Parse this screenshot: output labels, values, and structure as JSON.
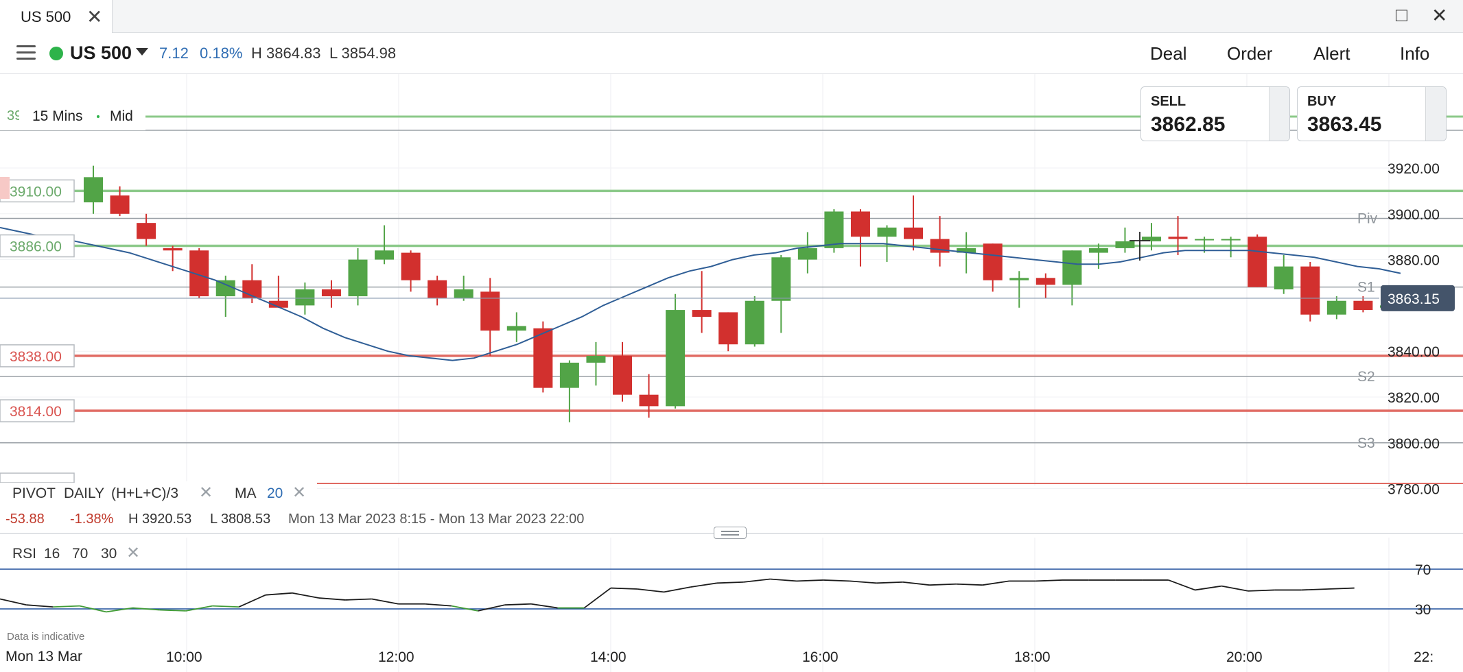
{
  "window": {
    "tab_title": "US 500",
    "close_glyph": "✕",
    "maximize_glyph": "□",
    "window_close_glyph": "✕"
  },
  "header": {
    "instrument": "US 500",
    "change": "7.12",
    "change_pct": "0.18%",
    "high": "H 3864.83",
    "low": "L 3854.98",
    "nav": [
      "Deal",
      "Order",
      "Alert",
      "Info"
    ]
  },
  "timeframe": {
    "cut_label": "39",
    "interval": "15 Mins",
    "mode": "Mid"
  },
  "quotes": {
    "sell_label": "SELL",
    "sell_price": "3862.85",
    "buy_label": "BUY",
    "buy_price": "3863.45"
  },
  "colors": {
    "up": "#52a447",
    "down": "#d2302e",
    "ma_line": "#2f5e96",
    "resistance": "#8cc98a",
    "support": "#e06a62",
    "pivot_line": "#9aa0a6",
    "current_badge": "#44546a",
    "rsi_band": "#1f4e9c"
  },
  "indicators": {
    "pivot_label": "PIVOT",
    "pivot_period": "DAILY",
    "pivot_formula": "(H+L+C)/3",
    "ma_label": "MA",
    "ma_period": "20",
    "remove_glyph": "✕"
  },
  "stats": {
    "change": "-53.88",
    "change_pct": "-1.38%",
    "high": "H 3920.53",
    "low": "L 3808.53",
    "range": "Mon 13 Mar 2023 8:15 - Mon 13 Mar 2023 22:00"
  },
  "rsi": {
    "label": "RSI",
    "period": "16",
    "upper": "70",
    "lower": "30",
    "values": [
      40,
      34,
      32,
      33,
      27,
      31,
      29,
      28,
      33,
      32,
      44,
      46,
      41,
      39,
      40,
      35,
      35,
      33,
      28,
      34,
      35,
      31,
      31,
      51,
      50,
      47,
      52,
      56,
      57,
      60,
      58,
      59,
      58,
      56,
      57,
      54,
      55,
      54,
      58,
      58,
      59,
      59,
      59,
      59,
      59,
      49,
      53,
      48,
      49,
      49,
      50,
      51
    ]
  },
  "footnote": "Data is indicative",
  "xaxis": {
    "first_label": "Mon 13 Mar",
    "labels": [
      "10:00",
      "12:00",
      "14:00",
      "16:00",
      "18:00",
      "20:00",
      "22:"
    ]
  },
  "levels": {
    "resistance": [
      {
        "value": 3910,
        "label": "3910.00"
      },
      {
        "value": 3886,
        "label": "3886.00"
      }
    ],
    "support": [
      {
        "value": 3838,
        "label": "3838.00"
      },
      {
        "value": 3814,
        "label": "3814.00"
      }
    ],
    "pivots": [
      {
        "value": 3898,
        "label": "Piv"
      },
      {
        "value": 3868,
        "label": "S1"
      },
      {
        "value": 3829,
        "label": "S2"
      },
      {
        "value": 3800,
        "label": "S3"
      }
    ],
    "current_price": {
      "value": 3863.15,
      "label": "3863.15"
    }
  },
  "chart_data": {
    "type": "candlestick",
    "title": "US 500",
    "y_ticks": [
      {
        "value": 3920,
        "label": "3920.00"
      },
      {
        "value": 3900,
        "label": "3900.00"
      },
      {
        "value": 3880,
        "label": "3880.00"
      },
      {
        "value": 3840,
        "label": "3840.00"
      },
      {
        "value": 3820,
        "label": "3820.00"
      },
      {
        "value": 3800,
        "label": "3800.00"
      },
      {
        "value": 3780,
        "label": "3780.00"
      }
    ],
    "ylim": [
      3774,
      3949
    ],
    "x_ticks": [
      "10:00",
      "12:00",
      "14:00",
      "16:00",
      "18:00",
      "20:00"
    ],
    "candles": [
      {
        "o": 3905,
        "h": 3921,
        "l": 3900,
        "c": 3916
      },
      {
        "o": 3908,
        "h": 3912,
        "l": 3899,
        "c": 3900
      },
      {
        "o": 3896,
        "h": 3900,
        "l": 3886,
        "c": 3889
      },
      {
        "o": 3885,
        "h": 3886,
        "l": 3875,
        "c": 3884
      },
      {
        "o": 3884,
        "h": 3885,
        "l": 3863,
        "c": 3864
      },
      {
        "o": 3864,
        "h": 3873,
        "l": 3855,
        "c": 3871
      },
      {
        "o": 3871,
        "h": 3878,
        "l": 3861,
        "c": 3863
      },
      {
        "o": 3862,
        "h": 3873,
        "l": 3859,
        "c": 3859
      },
      {
        "o": 3860,
        "h": 3870,
        "l": 3856,
        "c": 3867
      },
      {
        "o": 3867,
        "h": 3871,
        "l": 3859,
        "c": 3864
      },
      {
        "o": 3864,
        "h": 3885,
        "l": 3860,
        "c": 3880
      },
      {
        "o": 3880,
        "h": 3895,
        "l": 3878,
        "c": 3884
      },
      {
        "o": 3883,
        "h": 3884,
        "l": 3866,
        "c": 3871
      },
      {
        "o": 3871,
        "h": 3873,
        "l": 3860,
        "c": 3863
      },
      {
        "o": 3863,
        "h": 3873,
        "l": 3862,
        "c": 3867
      },
      {
        "o": 3866,
        "h": 3872,
        "l": 3838,
        "c": 3849
      },
      {
        "o": 3849,
        "h": 3857,
        "l": 3844,
        "c": 3851
      },
      {
        "o": 3850,
        "h": 3853,
        "l": 3822,
        "c": 3824
      },
      {
        "o": 3824,
        "h": 3836,
        "l": 3809,
        "c": 3835
      },
      {
        "o": 3835,
        "h": 3844,
        "l": 3825,
        "c": 3838
      },
      {
        "o": 3838,
        "h": 3844,
        "l": 3818,
        "c": 3821
      },
      {
        "o": 3821,
        "h": 3830,
        "l": 3811,
        "c": 3816
      },
      {
        "o": 3816,
        "h": 3865,
        "l": 3815,
        "c": 3858
      },
      {
        "o": 3858,
        "h": 3875,
        "l": 3848,
        "c": 3855
      },
      {
        "o": 3857,
        "h": 3857,
        "l": 3840,
        "c": 3843
      },
      {
        "o": 3843,
        "h": 3864,
        "l": 3842,
        "c": 3862
      },
      {
        "o": 3862,
        "h": 3882,
        "l": 3848,
        "c": 3881
      },
      {
        "o": 3880,
        "h": 3892,
        "l": 3874,
        "c": 3885
      },
      {
        "o": 3885,
        "h": 3902,
        "l": 3883,
        "c": 3901
      },
      {
        "o": 3901,
        "h": 3902,
        "l": 3877,
        "c": 3890
      },
      {
        "o": 3890,
        "h": 3895,
        "l": 3879,
        "c": 3894
      },
      {
        "o": 3894,
        "h": 3908,
        "l": 3884,
        "c": 3889
      },
      {
        "o": 3889,
        "h": 3899,
        "l": 3877,
        "c": 3883
      },
      {
        "o": 3883,
        "h": 3892,
        "l": 3874,
        "c": 3885
      },
      {
        "o": 3887,
        "h": 3887,
        "l": 3866,
        "c": 3871
      },
      {
        "o": 3871,
        "h": 3875,
        "l": 3859,
        "c": 3872
      },
      {
        "o": 3872,
        "h": 3874,
        "l": 3863,
        "c": 3869
      },
      {
        "o": 3869,
        "h": 3884,
        "l": 3860,
        "c": 3884
      },
      {
        "o": 3883,
        "h": 3887,
        "l": 3876,
        "c": 3885
      },
      {
        "o": 3885,
        "h": 3894,
        "l": 3883,
        "c": 3888
      },
      {
        "o": 3888,
        "h": 3896,
        "l": 3884,
        "c": 3890
      },
      {
        "o": 3890,
        "h": 3899,
        "l": 3882,
        "c": 3889
      },
      {
        "o": 3889,
        "h": 3890,
        "l": 3883,
        "c": 3889
      },
      {
        "o": 3889,
        "h": 3890,
        "l": 3881,
        "c": 3889
      },
      {
        "o": 3890,
        "h": 3891,
        "l": 3868,
        "c": 3868
      },
      {
        "o": 3867,
        "h": 3882,
        "l": 3865,
        "c": 3877
      },
      {
        "o": 3877,
        "h": 3879,
        "l": 3853,
        "c": 3856
      },
      {
        "o": 3856,
        "h": 3864,
        "l": 3854,
        "c": 3862
      },
      {
        "o": 3862,
        "h": 3864,
        "l": 3857,
        "c": 3858
      },
      {
        "o": 3859,
        "h": 3863,
        "l": 3858,
        "c": 3860
      },
      {
        "o": 3860,
        "h": 3865,
        "l": 3859,
        "c": 3865
      }
    ],
    "ma": [
      3894,
      3892,
      3890,
      3889,
      3887,
      3885,
      3883,
      3880,
      3877,
      3874,
      3871,
      3867,
      3863,
      3859,
      3855,
      3850,
      3846,
      3843,
      3840,
      3838,
      3837,
      3836,
      3837,
      3840,
      3843,
      3847,
      3851,
      3855,
      3860,
      3864,
      3868,
      3872,
      3875,
      3877,
      3880,
      3882,
      3883,
      3885,
      3886,
      3887,
      3887,
      3887,
      3886,
      3885,
      3884,
      3883,
      3882,
      3881,
      3880,
      3879,
      3878,
      3878,
      3879,
      3881,
      3883,
      3884,
      3884,
      3884,
      3884,
      3883,
      3882,
      3881,
      3879,
      3877,
      3876,
      3874
    ]
  }
}
